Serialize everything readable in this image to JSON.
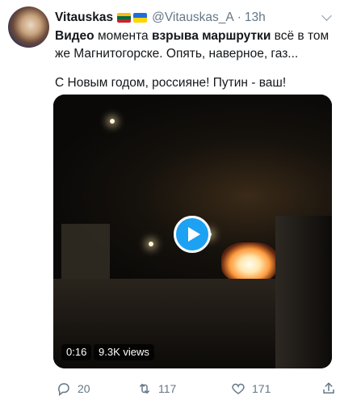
{
  "tweet": {
    "author_name": "Vitauskas",
    "flags": [
      "lithuania-flag",
      "ukraine-flag"
    ],
    "handle": "@Vitauskas_A",
    "separator": "·",
    "time": "13h",
    "text": {
      "line1_bold_a": "Видео",
      "line1_normal_a": " момента ",
      "line1_bold_b": "взрыва маршрутки",
      "line1_normal_b": " всё в том",
      "line2": "же Магнитогорске. Опять, наверное, газ...",
      "line3": "С Новым годом, россияне! Путин - ваш!"
    }
  },
  "media": {
    "duration": "0:16",
    "views": "9.3K views",
    "play_icon": "play-icon"
  },
  "actions": {
    "reply_count": "20",
    "retweet_count": "117",
    "like_count": "171"
  },
  "colors": {
    "accent": "#1da1f2",
    "secondary_text": "#657786",
    "primary_text": "#14171a"
  }
}
